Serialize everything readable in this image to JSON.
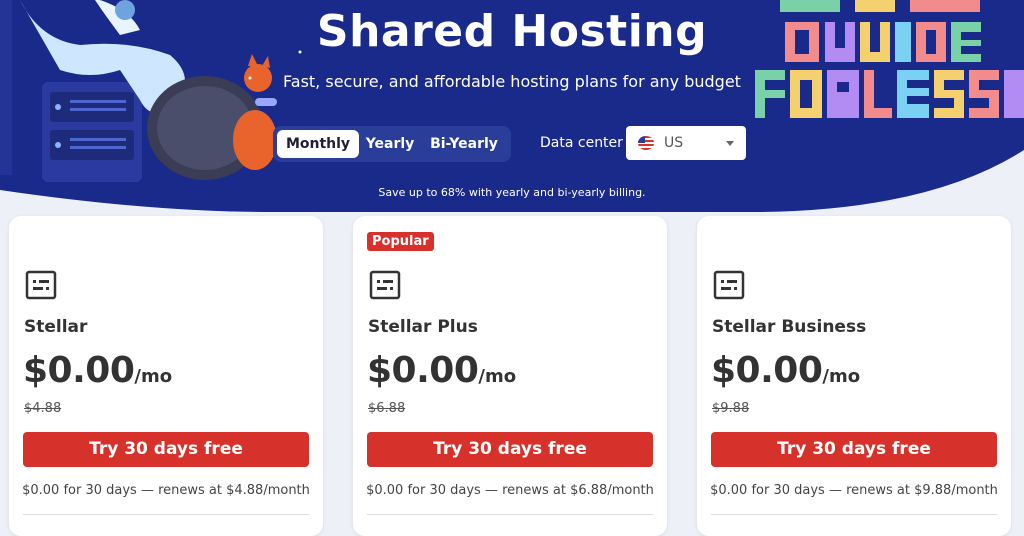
{
  "hero": {
    "title": "Shared Hosting",
    "subtitle": "Fast, secure, and affordable hosting plans for any budget",
    "billing_options": [
      "Monthly",
      "Yearly",
      "Bi-Yearly"
    ],
    "selected_billing": "Monthly",
    "data_center_label": "Data center",
    "data_center_value": "US",
    "save_note": "Save up to 68% with yearly and bi-yearly billing."
  },
  "plans": [
    {
      "badge": "",
      "name": "Stellar",
      "price": "$0.00",
      "per": "/mo",
      "old_price": "$4.88",
      "cta": "Try 30 days free",
      "renew": "$0.00 for 30 days — renews at $4.88/month"
    },
    {
      "badge": "Popular",
      "name": "Stellar Plus",
      "price": "$0.00",
      "per": "/mo",
      "old_price": "$6.88",
      "cta": "Try 30 days free",
      "renew": "$0.00 for 30 days — renews at $6.88/month"
    },
    {
      "badge": "",
      "name": "Stellar Business",
      "price": "$0.00",
      "per": "/mo",
      "old_price": "$9.88",
      "cta": "Try 30 days free",
      "renew": "$0.00 for 30 days — renews at $9.88/month"
    }
  ],
  "colors": {
    "hero_bg": "#1a2a8a",
    "accent_red": "#d6322b",
    "toggle_bg": "#2a3d98"
  },
  "icons": [
    "server-rack-illustration",
    "mascot-illustration",
    "hedgehog-illustration",
    "pixel-letters-illustration",
    "us-flag-icon",
    "chevron-down-icon",
    "plan-icon"
  ]
}
